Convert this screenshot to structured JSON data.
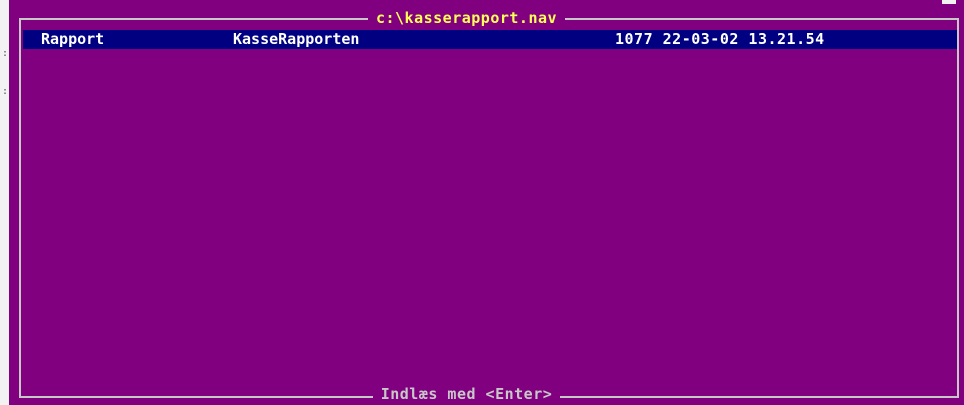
{
  "window": {
    "title": "c:\\kasserapport.nav",
    "footer_hint": "Indlæs med <Enter>"
  },
  "list": {
    "selected_row": {
      "type": "Rapport",
      "name": "KasseRapporten",
      "info": "1077 22-03-02 13.21.54"
    }
  },
  "colors": {
    "background": "#800080",
    "selection": "#000080",
    "title_text": "#ffff55",
    "frame": "#c8c8c8"
  }
}
